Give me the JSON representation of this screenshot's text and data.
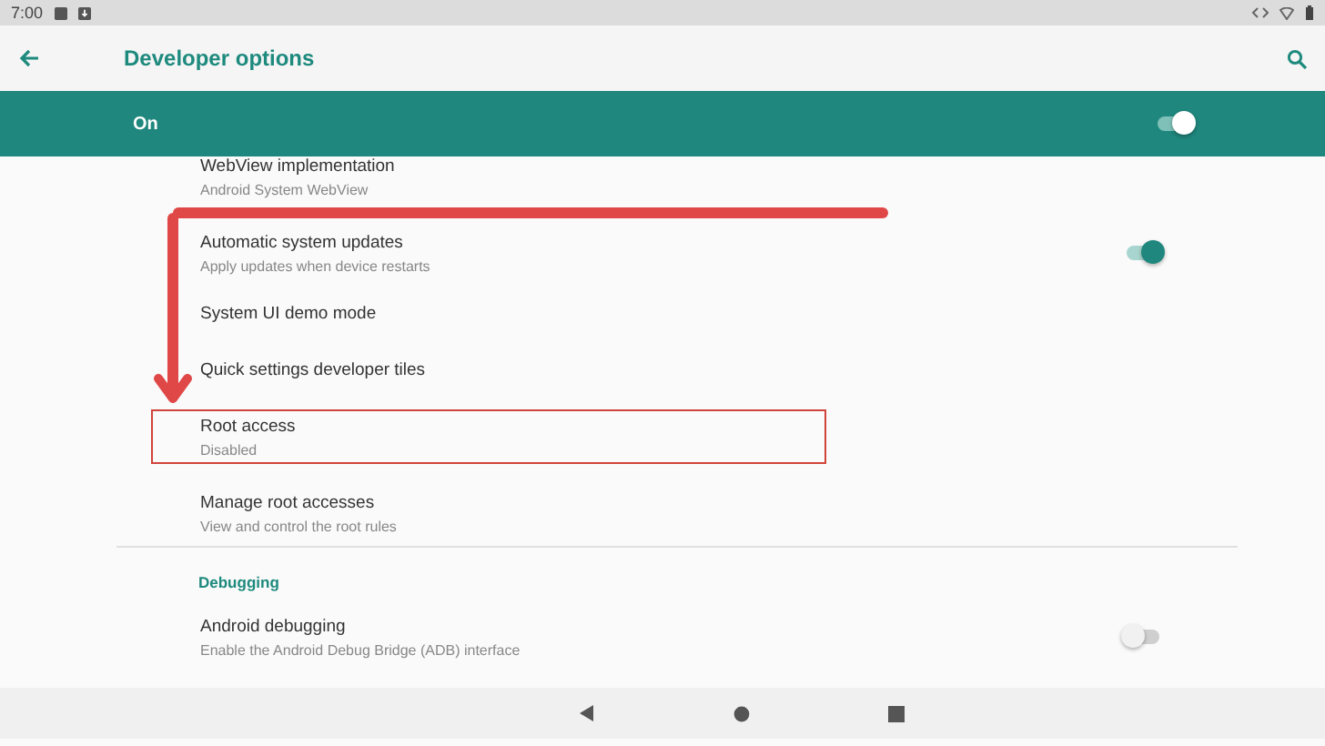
{
  "status_bar": {
    "time": "7:00"
  },
  "app_bar": {
    "title": "Developer options"
  },
  "master_switch": {
    "label": "On",
    "on": true
  },
  "items": [
    {
      "kind": "setting",
      "title": "WebView implementation",
      "summary": "Android System WebView",
      "highlighted": false
    },
    {
      "kind": "toggle",
      "title": "Automatic system updates",
      "summary": "Apply updates when device restarts",
      "on": true,
      "highlighted": false
    },
    {
      "kind": "setting",
      "title": "System UI demo mode",
      "highlighted": false
    },
    {
      "kind": "setting",
      "title": "Quick settings developer tiles",
      "highlighted": false
    },
    {
      "kind": "setting",
      "title": "Root access",
      "summary": "Disabled",
      "highlighted": true
    },
    {
      "kind": "setting",
      "title": "Manage root accesses",
      "summary": "View and control the root rules",
      "highlighted": false
    },
    {
      "kind": "divider"
    },
    {
      "kind": "header",
      "title": "Debugging"
    },
    {
      "kind": "toggle",
      "title": "Android debugging",
      "summary": "Enable the Android Debug Bridge (ADB) interface",
      "on": false,
      "highlighted": false
    }
  ]
}
